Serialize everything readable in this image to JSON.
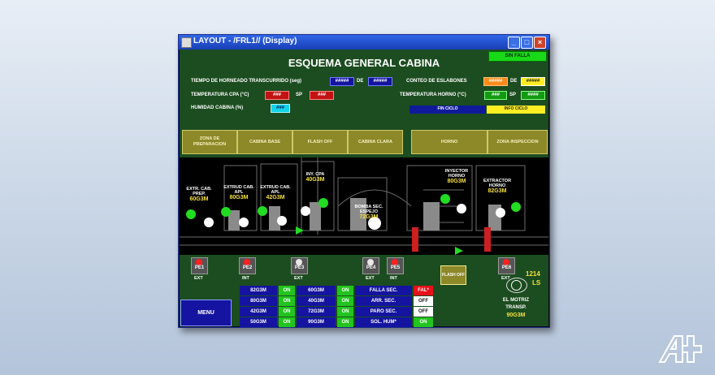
{
  "window": {
    "title": "LAYOUT - /FRL1// (Display)"
  },
  "screen": {
    "status_badge": "SIN FALLA",
    "title": "ESQUEMA GENERAL CABINA",
    "params": {
      "tiempo_label": "TIEMPO DE HORNEADO TRANSCURRIDO (seg)",
      "tiempo_val1": "#####",
      "tiempo_de": "DE",
      "tiempo_val2": "#####",
      "conteo_label": "CONTEO DE ESLABONES",
      "conteo_val1": "#####",
      "conteo_de": "DE",
      "conteo_val2": "#####",
      "temp_cpa_label": "TEMPERATURA CPA (°C)",
      "temp_cpa_val": "###",
      "temp_cpa_sp": "SP",
      "temp_cpa_spval": "###",
      "temp_horno_label": "TEMPERATURA HORNO (°C)",
      "temp_horno_val": "###",
      "temp_horno_sp": "SP",
      "temp_horno_spval": "####",
      "humedad_label": "HUMIDAD CABINA (%)",
      "humedad_val": "###"
    },
    "oven_indicators": {
      "left": "FIN CICLO",
      "right": "INFO CICLO"
    },
    "zones": [
      "ZONA DE PREPARACION",
      "CABINA BASE",
      "FLASH OFF",
      "CABINA CLARA",
      "HORNO",
      "ZONA INSPECCION"
    ],
    "equipment": [
      {
        "name": "EXTR. CAB. PREP.",
        "value": "60G3M"
      },
      {
        "name": "EXTRUD CAB. APL",
        "value": "80G3M"
      },
      {
        "name": "EXTRUD CAB. APL",
        "value": "42G3M"
      },
      {
        "name": "INY. CPA",
        "value": "40G3M"
      },
      {
        "name": "BOMBA SEC. ESPEJO",
        "value": "72G3M"
      },
      {
        "name": "INYECTOR HORNO",
        "value": "80G3M"
      },
      {
        "name": "EXTRACTOR HORNO",
        "value": "82G3M"
      }
    ],
    "pe_units": [
      {
        "name": "PE1",
        "tag": "EXT",
        "color": "#ff2020"
      },
      {
        "name": "PE2",
        "tag": "INT",
        "color": "#ff2020"
      },
      {
        "name": "PE3",
        "tag": "EXT",
        "color": "#e8e8e8"
      },
      {
        "name": "PE4",
        "tag": "EXT",
        "color": "#e8e8e8"
      },
      {
        "name": "PE5",
        "tag": "INT",
        "color": "#ff2020"
      },
      {
        "name": "PE6",
        "tag": "EXT",
        "color": "#ff2020"
      }
    ],
    "flash_off_box": "FLASH OFF",
    "counter": {
      "value": "1214",
      "unit": "LS"
    },
    "menu_button": "MENU",
    "motor": {
      "line1": "EL MOTRIZ",
      "line2": "TRANSP.",
      "value": "90G3M"
    },
    "table": {
      "rows": [
        {
          "a": "82G3M",
          "a_state": "ON",
          "b": "60G3M",
          "b_state": "ON",
          "label": "FALLA SEC.",
          "status": "FAL*",
          "status_color": "#e8101a"
        },
        {
          "a": "80G3M",
          "a_state": "ON",
          "b": "40G3M",
          "b_state": "ON",
          "label": "ARR. SEC.",
          "status": "OFF",
          "status_color": "#ffffff"
        },
        {
          "a": "42G3M",
          "a_state": "ON",
          "b": "72G3M",
          "b_state": "ON",
          "label": "PARO SEC.",
          "status": "OFF",
          "status_color": "#ffffff"
        },
        {
          "a": "50G3M",
          "a_state": "ON",
          "b": "90G3M",
          "b_state": "ON",
          "label": "SOL. HUM*",
          "status": "ON",
          "status_color": "#22c41e"
        }
      ]
    }
  },
  "logo": "A+",
  "colors": {
    "panel_green": "#1c4d20",
    "value_blue": "#1414a0",
    "on_green": "#22c41e",
    "alarm_red": "#e8101a",
    "zone_olive": "#8d8828"
  }
}
